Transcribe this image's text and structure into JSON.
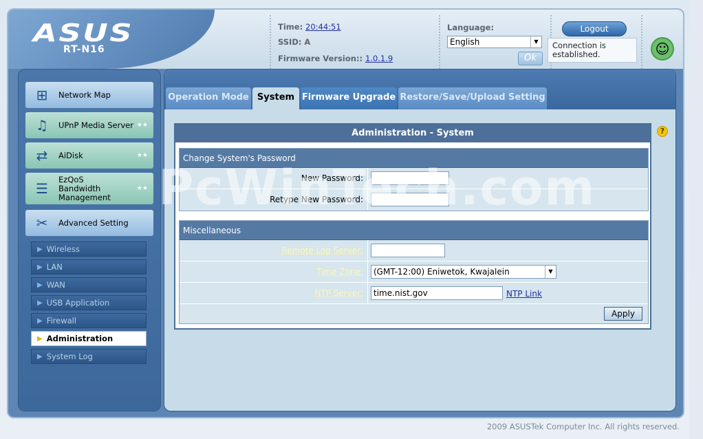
{
  "header": {
    "logo": "ASUS",
    "model": "RT-N16",
    "time_label": "Time:",
    "time_value": "20:44:51",
    "ssid_label": "SSID:",
    "ssid_value": "A",
    "firmware_label": "Firmware Version::",
    "firmware_value": "1.0.1.9",
    "language_label": "Language:",
    "language_selected": "English",
    "ok_label": "Ok",
    "logout_label": "Logout",
    "connection_status": "Connection is established."
  },
  "sidebar": {
    "main_items": [
      {
        "label": "Network Map",
        "icon": "network-map-icon"
      },
      {
        "label": "UPnP Media Server",
        "icon": "media-server-icon"
      },
      {
        "label": "AiDisk",
        "icon": "aidisk-icon"
      },
      {
        "label": "EzQoS Bandwidth Management",
        "icon": "qos-icon"
      },
      {
        "label": "Advanced Setting",
        "icon": "tools-icon"
      }
    ],
    "sub_items": [
      "Wireless",
      "LAN",
      "WAN",
      "USB Application",
      "Firewall",
      "Administration",
      "System Log"
    ],
    "active_sub_item": "Administration"
  },
  "tabs": [
    "Operation Mode",
    "System",
    "Firmware Upgrade",
    "Restore/Save/Upload Setting"
  ],
  "active_tab": "System",
  "panel": {
    "title": "Administration - System",
    "password_section": {
      "heading": "Change System's Password",
      "new_password_label": "New Password:",
      "retype_password_label": "Retype New Password:"
    },
    "misc_section": {
      "heading": "Miscellaneous",
      "remote_log_label": "Remote Log Server:",
      "remote_log_value": "",
      "timezone_label": "Time Zone:",
      "timezone_value": "(GMT-12:00) Eniwetok, Kwajalein",
      "ntp_label": "NTP Server:",
      "ntp_value": "time.nist.gov",
      "ntp_link": "NTP Link"
    },
    "apply_label": "Apply"
  },
  "watermark": "PcWinTech.com",
  "footer": "2009 ASUSTek Computer Inc. All rights reserved."
}
